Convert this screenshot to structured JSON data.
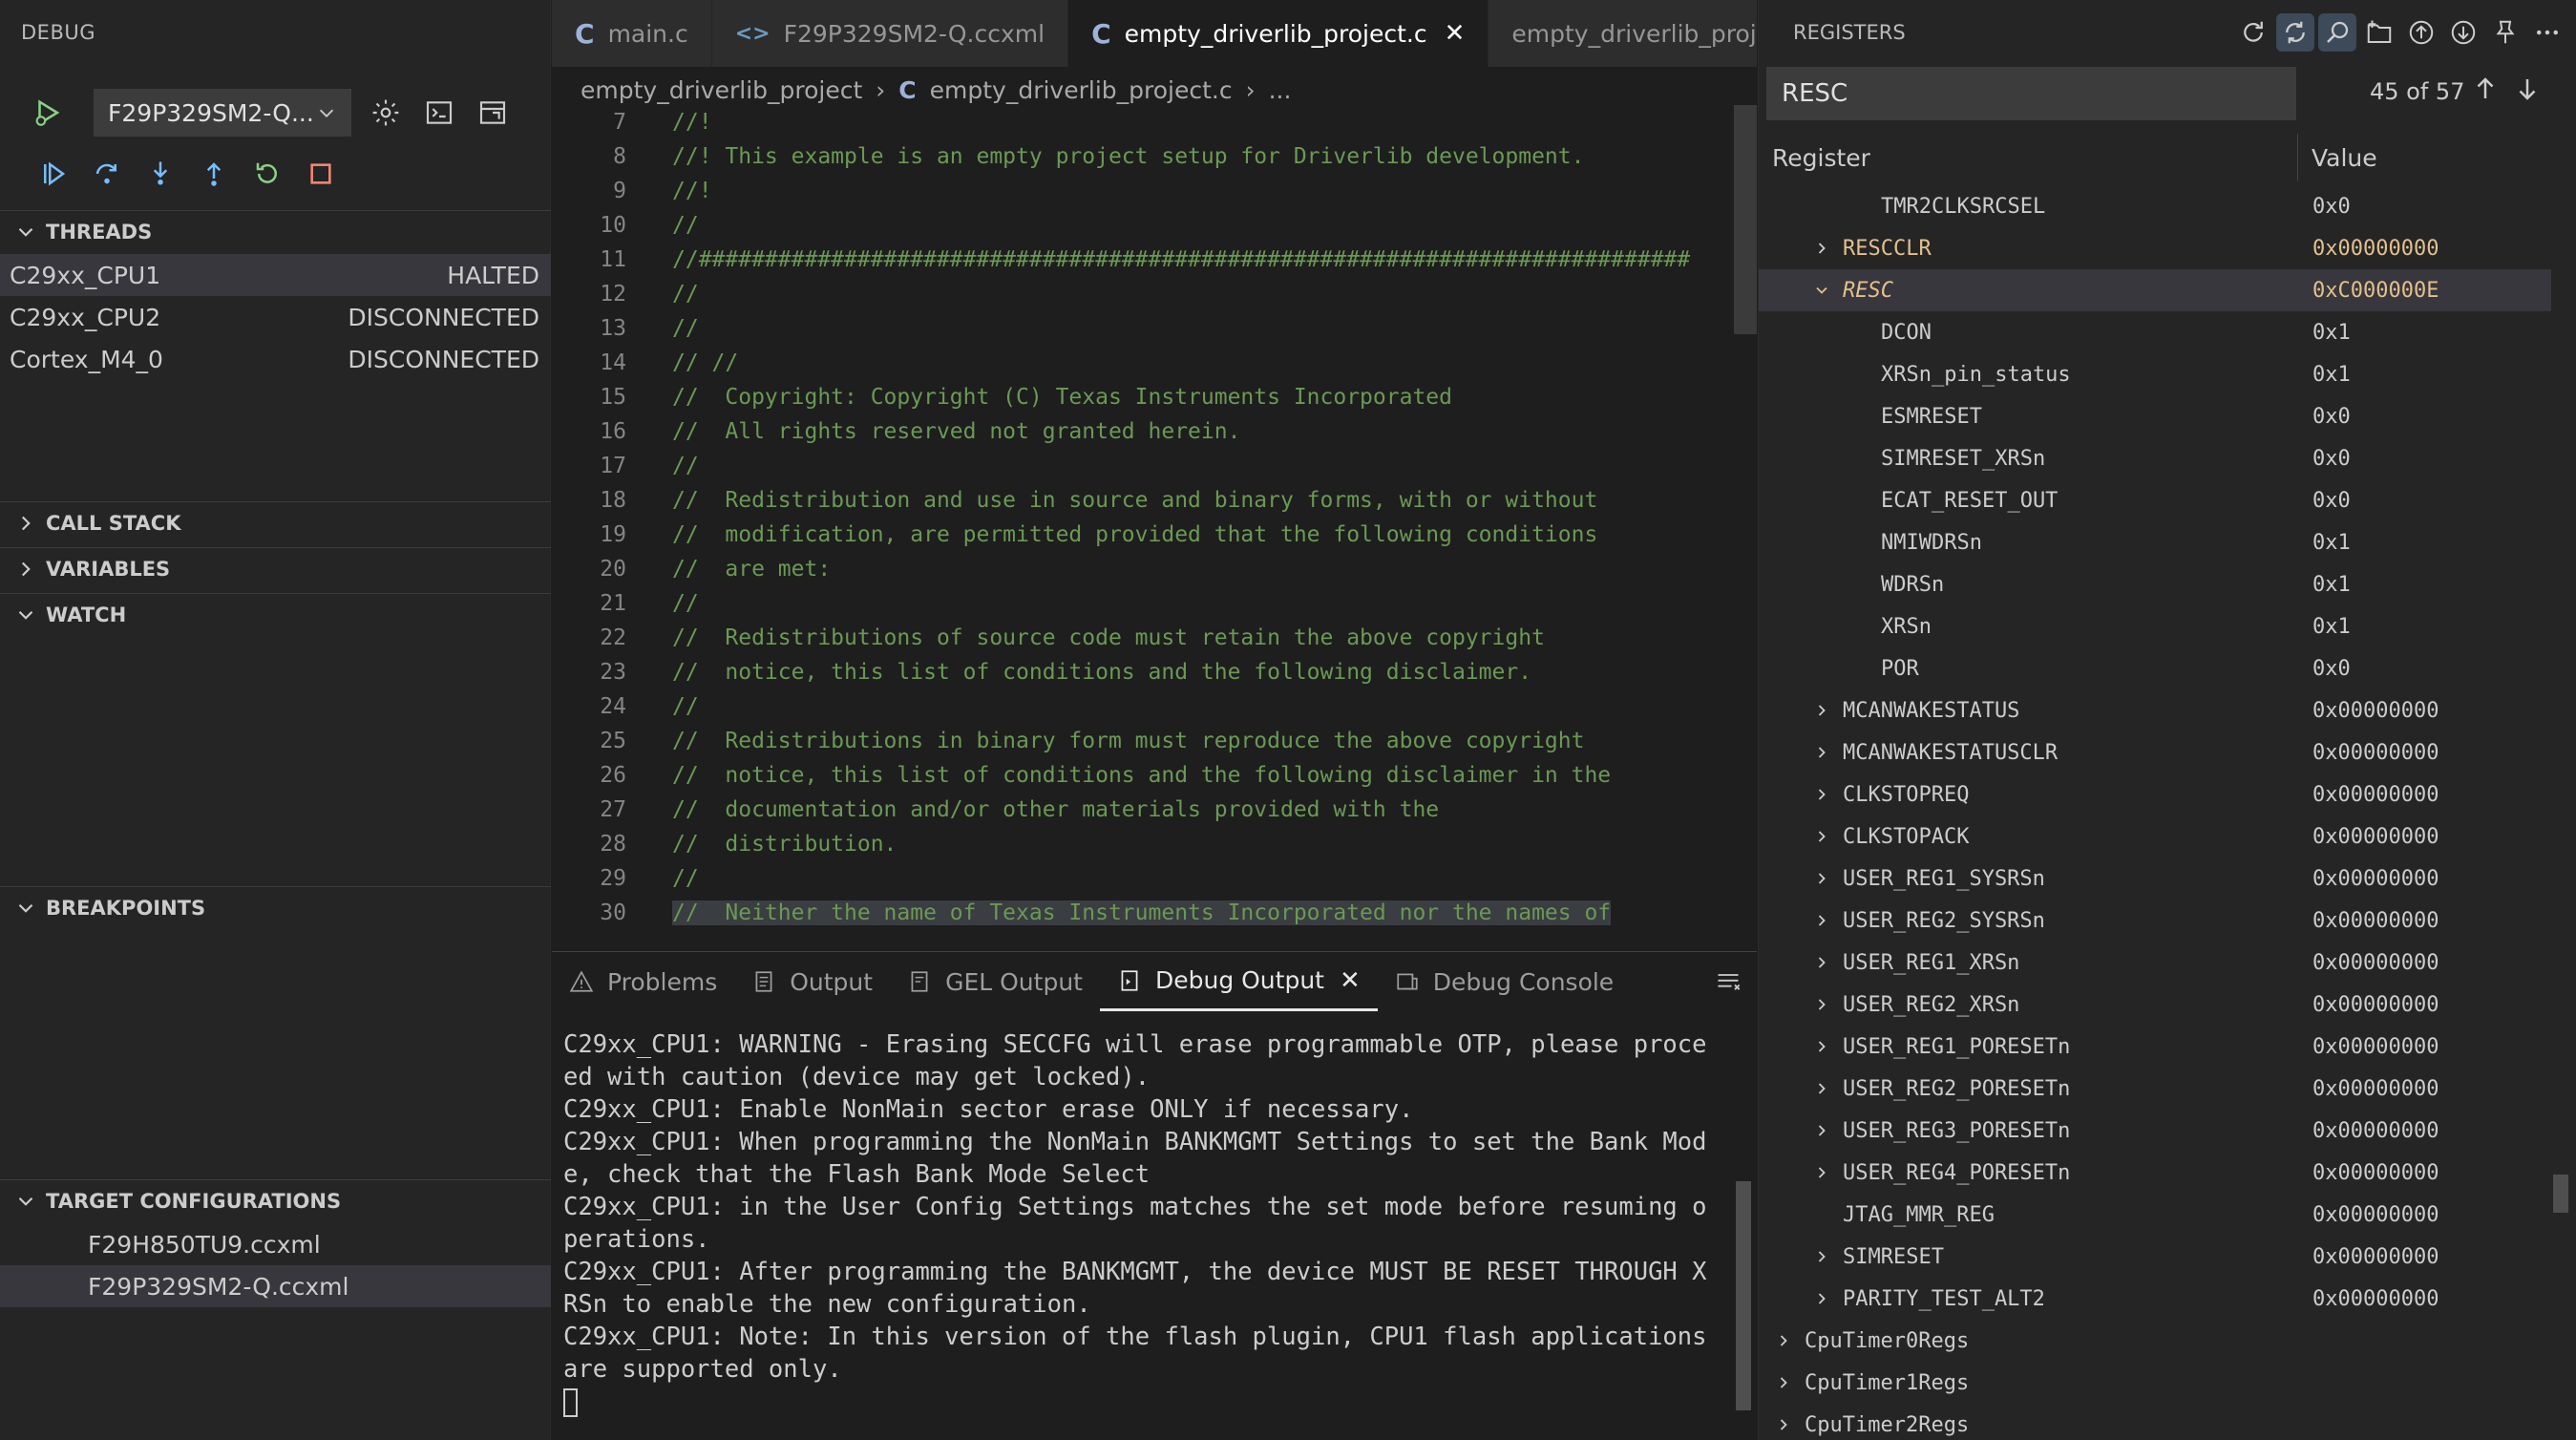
{
  "sidebar": {
    "title": "DEBUG",
    "config_selected": "F29P329SM2-Q...",
    "sections": {
      "threads": "THREADS",
      "call_stack": "CALL STACK",
      "variables": "VARIABLES",
      "watch": "WATCH",
      "breakpoints": "BREAKPOINTS",
      "target_configurations": "TARGET CONFIGURATIONS"
    },
    "threads": [
      {
        "name": "C29xx_CPU1",
        "status": "HALTED"
      },
      {
        "name": "C29xx_CPU2",
        "status": "DISCONNECTED"
      },
      {
        "name": "Cortex_M4_0",
        "status": "DISCONNECTED"
      }
    ],
    "targets": [
      "F29H850TU9.ccxml",
      "F29P329SM2-Q.ccxml"
    ]
  },
  "editor": {
    "tabs": [
      {
        "label": "main.c",
        "icon": "C"
      },
      {
        "label": "F29P329SM2-Q.ccxml",
        "icon": "<>"
      },
      {
        "label": "empty_driverlib_project.c",
        "icon": "C"
      },
      {
        "label": "empty_driverlib_proje",
        "icon": ""
      }
    ],
    "breadcrumb": {
      "folder": "empty_driverlib_project",
      "file": "empty_driverlib_project.c",
      "more": "..."
    },
    "lines": [
      {
        "n": "7",
        "t": "//!"
      },
      {
        "n": "8",
        "t": "//! This example is an empty project setup for Driverlib development."
      },
      {
        "n": "9",
        "t": "//!"
      },
      {
        "n": "10",
        "t": "//"
      },
      {
        "n": "11",
        "t": "//###########################################################################"
      },
      {
        "n": "12",
        "t": "//"
      },
      {
        "n": "13",
        "t": "//"
      },
      {
        "n": "14",
        "t": "// //"
      },
      {
        "n": "15",
        "t": "//  Copyright: Copyright (C) Texas Instruments Incorporated"
      },
      {
        "n": "16",
        "t": "//  All rights reserved not granted herein."
      },
      {
        "n": "17",
        "t": "//"
      },
      {
        "n": "18",
        "t": "//  Redistribution and use in source and binary forms, with or without"
      },
      {
        "n": "19",
        "t": "//  modification, are permitted provided that the following conditions"
      },
      {
        "n": "20",
        "t": "//  are met:"
      },
      {
        "n": "21",
        "t": "//"
      },
      {
        "n": "22",
        "t": "//  Redistributions of source code must retain the above copyright"
      },
      {
        "n": "23",
        "t": "//  notice, this list of conditions and the following disclaimer."
      },
      {
        "n": "24",
        "t": "//"
      },
      {
        "n": "25",
        "t": "//  Redistributions in binary form must reproduce the above copyright"
      },
      {
        "n": "26",
        "t": "//  notice, this list of conditions and the following disclaimer in the"
      },
      {
        "n": "27",
        "t": "//  documentation and/or other materials provided with the"
      },
      {
        "n": "28",
        "t": "//  distribution."
      },
      {
        "n": "29",
        "t": "//"
      },
      {
        "n": "30",
        "t": "//  Neither the name of Texas Instruments Incorporated nor the names of"
      }
    ]
  },
  "panel": {
    "tabs": [
      "Problems",
      "Output",
      "GEL Output",
      "Debug Output",
      "Debug Console"
    ],
    "output": "C29xx_CPU1: WARNING - Erasing SECCFG will erase programmable OTP, please proceed with caution (device may get locked).\nC29xx_CPU1: Enable NonMain sector erase ONLY if necessary.\nC29xx_CPU1: When programming the NonMain BANKMGMT Settings to set the Bank Mode, check that the Flash Bank Mode Select\nC29xx_CPU1: in the User Config Settings matches the set mode before resuming operations.\nC29xx_CPU1: After programming the BANKMGMT, the device MUST BE RESET THROUGH XRSn to enable the new configuration.\nC29xx_CPU1: Note: In this version of the flash plugin, CPU1 flash applications are supported only."
  },
  "registers": {
    "title": "REGISTERS",
    "search": "RESC",
    "match_count": "45 of 57",
    "col_register": "Register",
    "col_value": "Value",
    "rows": [
      {
        "name": "TMR2CLKSRCSEL",
        "value": "0x0",
        "level": 2,
        "expand": "none"
      },
      {
        "name": "RESCCLR",
        "value": "0x00000000",
        "level": 1,
        "expand": "collapsed",
        "changed": true
      },
      {
        "name": "RESC",
        "value": "0xC000000E",
        "level": 1,
        "expand": "expanded",
        "changed": true,
        "selected": true
      },
      {
        "name": "DCON",
        "value": "0x1",
        "level": 2,
        "expand": "none"
      },
      {
        "name": "XRSn_pin_status",
        "value": "0x1",
        "level": 2,
        "expand": "none"
      },
      {
        "name": "ESMRESET",
        "value": "0x0",
        "level": 2,
        "expand": "none"
      },
      {
        "name": "SIMRESET_XRSn",
        "value": "0x0",
        "level": 2,
        "expand": "none"
      },
      {
        "name": "ECAT_RESET_OUT",
        "value": "0x0",
        "level": 2,
        "expand": "none"
      },
      {
        "name": "NMIWDRSn",
        "value": "0x1",
        "level": 2,
        "expand": "none"
      },
      {
        "name": "WDRSn",
        "value": "0x1",
        "level": 2,
        "expand": "none"
      },
      {
        "name": "XRSn",
        "value": "0x1",
        "level": 2,
        "expand": "none"
      },
      {
        "name": "POR",
        "value": "0x0",
        "level": 2,
        "expand": "none"
      },
      {
        "name": "MCANWAKESTATUS",
        "value": "0x00000000",
        "level": 1,
        "expand": "collapsed"
      },
      {
        "name": "MCANWAKESTATUSCLR",
        "value": "0x00000000",
        "level": 1,
        "expand": "collapsed"
      },
      {
        "name": "CLKSTOPREQ",
        "value": "0x00000000",
        "level": 1,
        "expand": "collapsed"
      },
      {
        "name": "CLKSTOPACK",
        "value": "0x00000000",
        "level": 1,
        "expand": "collapsed"
      },
      {
        "name": "USER_REG1_SYSRSn",
        "value": "0x00000000",
        "level": 1,
        "expand": "collapsed"
      },
      {
        "name": "USER_REG2_SYSRSn",
        "value": "0x00000000",
        "level": 1,
        "expand": "collapsed"
      },
      {
        "name": "USER_REG1_XRSn",
        "value": "0x00000000",
        "level": 1,
        "expand": "collapsed"
      },
      {
        "name": "USER_REG2_XRSn",
        "value": "0x00000000",
        "level": 1,
        "expand": "collapsed"
      },
      {
        "name": "USER_REG1_PORESETn",
        "value": "0x00000000",
        "level": 1,
        "expand": "collapsed"
      },
      {
        "name": "USER_REG2_PORESETn",
        "value": "0x00000000",
        "level": 1,
        "expand": "collapsed"
      },
      {
        "name": "USER_REG3_PORESETn",
        "value": "0x00000000",
        "level": 1,
        "expand": "collapsed"
      },
      {
        "name": "USER_REG4_PORESETn",
        "value": "0x00000000",
        "level": 1,
        "expand": "collapsed"
      },
      {
        "name": "JTAG_MMR_REG",
        "value": "0x00000000",
        "level": 1,
        "expand": "none"
      },
      {
        "name": "SIMRESET",
        "value": "0x00000000",
        "level": 1,
        "expand": "collapsed"
      },
      {
        "name": "PARITY_TEST_ALT2",
        "value": "0x00000000",
        "level": 1,
        "expand": "collapsed"
      },
      {
        "name": "CpuTimer0Regs",
        "value": "",
        "level": 0,
        "expand": "collapsed"
      },
      {
        "name": "CpuTimer1Regs",
        "value": "",
        "level": 0,
        "expand": "collapsed"
      },
      {
        "name": "CpuTimer2Regs",
        "value": "",
        "level": 0,
        "expand": "collapsed"
      }
    ]
  },
  "colors": {
    "background": "#1e1e1e",
    "sidebar": "#252526",
    "comment": "#6a9955",
    "changed_value": "#e2c08d",
    "debug_accent": "#75beff",
    "stop": "#f48771",
    "run": "#89d185"
  }
}
